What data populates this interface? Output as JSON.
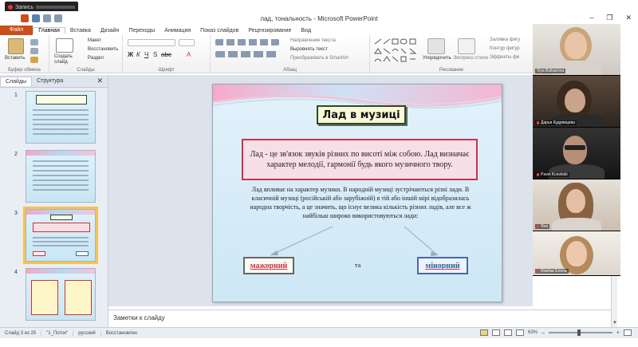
{
  "recording": {
    "label": "Запись"
  },
  "app": {
    "title": "лад, тональность - Microsoft PowerPoint"
  },
  "ribbon_tabs": [
    "Главная",
    "Вставка",
    "Дизайн",
    "Переходы",
    "Анимация",
    "Показ слайдов",
    "Рецензирование",
    "Вид"
  ],
  "file_tab": "Файл",
  "ribbon": {
    "clipboard": {
      "label": "Буфер обмена",
      "paste": "Вставить"
    },
    "slides": {
      "label": "Слайды",
      "create": "Создать слайд",
      "layout": "Макет",
      "reset": "Восстановить",
      "section": "Раздел"
    },
    "font": {
      "label": "Шрифт"
    },
    "paragraph": {
      "label": "Абзац",
      "text_direction": "Направление текста",
      "align_text": "Выровнять текст",
      "smartart": "Преобразовать в SmartArt"
    },
    "drawing": {
      "label": "Рисование",
      "arrange": "Упорядочить",
      "quick_styles": "Экспресс-стили",
      "fill": "Заливка фигу",
      "outline": "Контур фигур",
      "effects": "Эффекты фи"
    }
  },
  "left_panel": {
    "tabs": [
      "Слайды",
      "Структура"
    ],
    "close_glyph": "✕",
    "slide_numbers": [
      "1",
      "2",
      "3",
      "4"
    ],
    "selected_index": 2
  },
  "slide": {
    "title": "Лад в музиці",
    "definition": "Лад - це зв'язок звуків різних по висоті між собою. Лад визначає характер мелодії, гармонії будь якого музичного твору.",
    "body": "Лад впливає на характер музики. В народній музиці зустрічаються різні лади. В класичній музиці (російській або зарубіжній) в тій або іншій мірі відобразилась народна творчість, а це значить, що існує велика кількість різних ладів, але все ж найбільш широко використовуються лади:",
    "major": "мажорний",
    "conjunction": "та",
    "minor": "мінорний"
  },
  "notes": {
    "placeholder": "Заметки к слайду"
  },
  "status": {
    "slide_counter": "Слайд 3 из 25",
    "theme": "\"1_Поток\"",
    "language": "русский",
    "state": "Восстановлен",
    "zoom": "63%"
  },
  "participants": [
    {
      "name": "Viya Bulkazova",
      "muted": false
    },
    {
      "name": "Дарья Кудрявцева",
      "muted": true
    },
    {
      "name": "Pavel Kcevitski",
      "muted": true
    },
    {
      "name": "Яна",
      "muted": true
    },
    {
      "name": "Йовбак Елена",
      "muted": true
    }
  ],
  "colors": {
    "file_tab": "#c94f1b",
    "definition_border": "#c8344a",
    "minor_text": "#2f5f9a",
    "selected_thumb": "#f5c34d"
  }
}
